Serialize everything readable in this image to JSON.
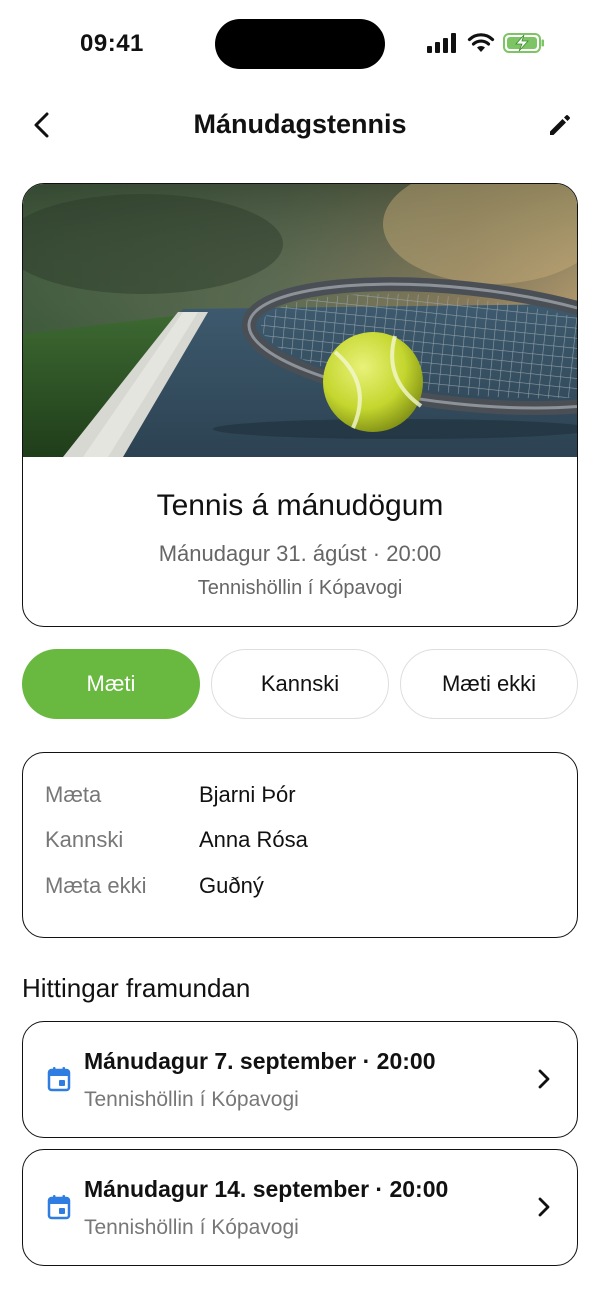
{
  "status_bar": {
    "time": "09:41"
  },
  "header": {
    "title": "Mánudagstennis"
  },
  "event": {
    "title": "Tennis á mánudögum",
    "date_time": "Mánudagur 31. ágúst · 20:00",
    "location": "Tennishöllin í Kópavogi"
  },
  "rsvp": {
    "going": "Mæti",
    "maybe": "Kannski",
    "not_going": "Mæti ekki"
  },
  "attendance": [
    {
      "label": "Mæta",
      "value": "Bjarni Þór"
    },
    {
      "label": "Kannski",
      "value": "Anna Rósa"
    },
    {
      "label": "Mæta ekki",
      "value": "Guðný"
    }
  ],
  "upcoming": {
    "title": "Hittingar framundan",
    "items": [
      {
        "title": "Mánudagur 7. september · 20:00",
        "location": "Tennishöllin í Kópavogi"
      },
      {
        "title": "Mánudagur 14. september · 20:00",
        "location": "Tennishöllin í Kópavogi"
      }
    ]
  },
  "colors": {
    "accent_green": "#69b83f",
    "link_blue": "#2f7de1",
    "calendar_icon": "#2f7de1"
  },
  "icons": {
    "back": "chevron-left-icon",
    "edit": "pencil-icon",
    "calendar": "calendar-icon",
    "chevron": "chevron-right-icon"
  }
}
